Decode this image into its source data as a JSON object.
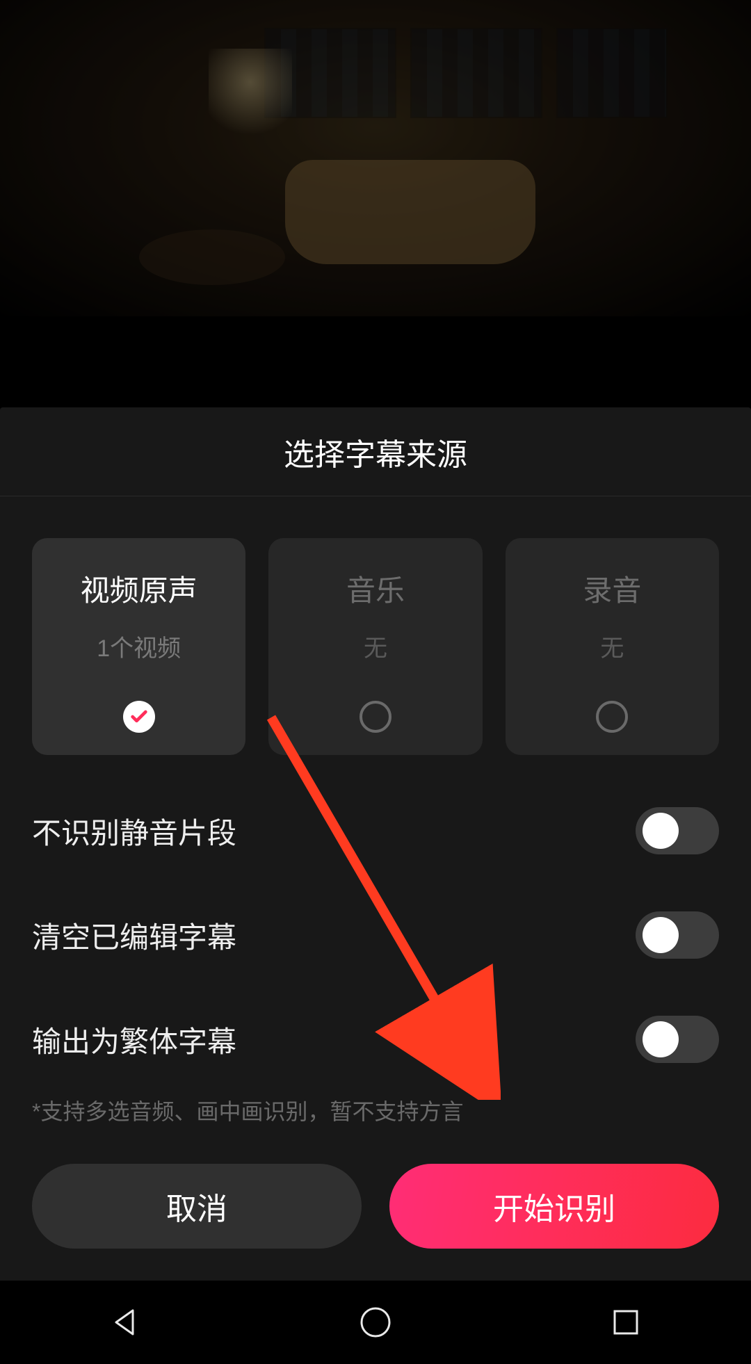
{
  "colors": {
    "accent": "#ff2d5a"
  },
  "sheet": {
    "title": "选择字幕来源",
    "options": [
      {
        "title": "视频原声",
        "sub": "1个视频",
        "selected": true
      },
      {
        "title": "音乐",
        "sub": "无",
        "selected": false
      },
      {
        "title": "录音",
        "sub": "无",
        "selected": false
      }
    ],
    "settings": [
      {
        "label": "不识别静音片段",
        "on": false
      },
      {
        "label": "清空已编辑字幕",
        "on": false
      },
      {
        "label": "输出为繁体字幕",
        "on": false
      }
    ],
    "hint": "*支持多选音频、画中画识别，暂不支持方言",
    "cancel": "取消",
    "confirm": "开始识别"
  }
}
